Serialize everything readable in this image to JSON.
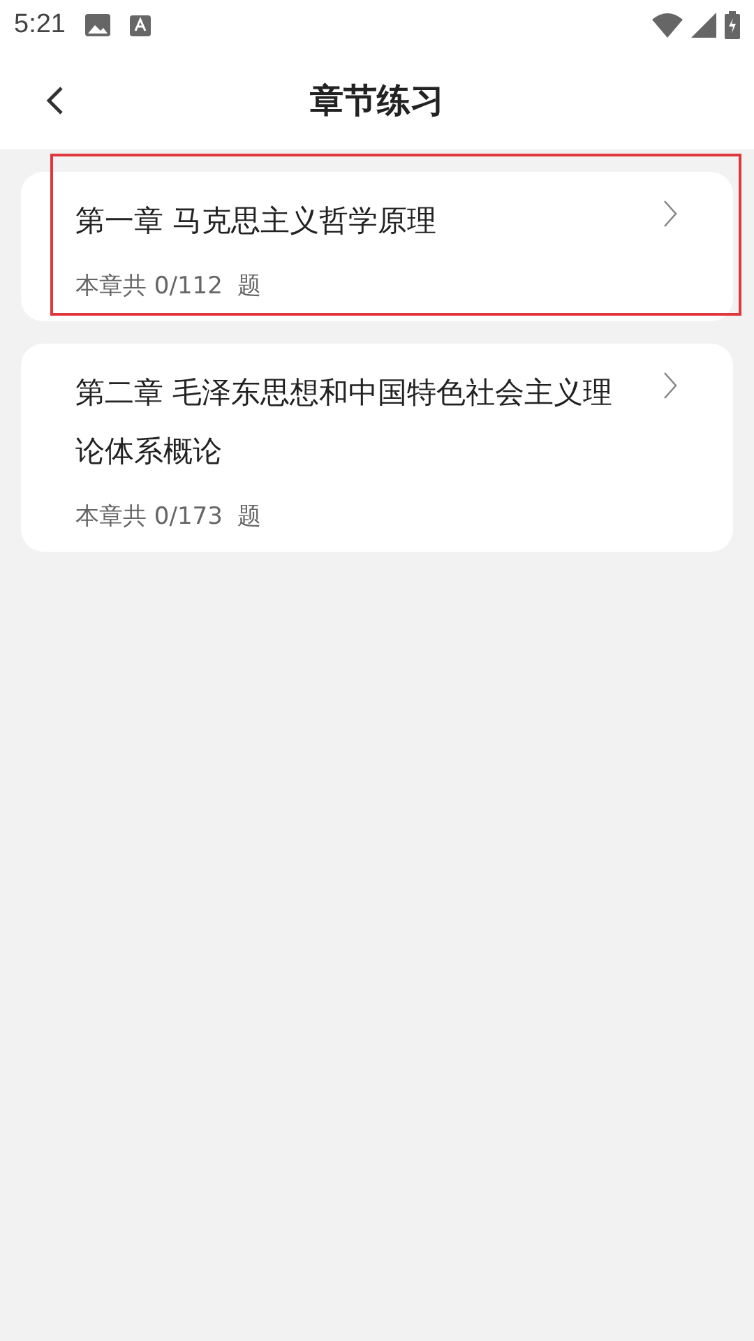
{
  "status_bar": {
    "time": "5:21"
  },
  "header": {
    "title": "章节练习"
  },
  "chapters": [
    {
      "title": "第一章 马克思主义哲学原理",
      "count": "本章共 0/112  题",
      "highlighted": true
    },
    {
      "title": "第二章 毛泽东思想和中国特色社会主义理论体系概论",
      "count": "本章共 0/173  题",
      "highlighted": false
    }
  ]
}
